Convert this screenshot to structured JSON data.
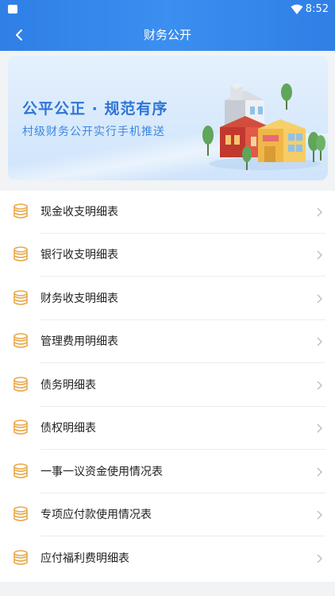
{
  "status_bar": {
    "time": "8:52"
  },
  "nav": {
    "title": "财务公开"
  },
  "banner": {
    "slogan": "公平公正 · 规范有序",
    "subslogan": "村级财务公开实行手机推送"
  },
  "colors": {
    "accent": "#2f7fe6",
    "coin": "#e8a94a"
  },
  "list": {
    "items": [
      {
        "label": "现金收支明细表",
        "icon": "coin-stack-icon"
      },
      {
        "label": "银行收支明细表",
        "icon": "coin-stack-icon"
      },
      {
        "label": "财务收支明细表",
        "icon": "coin-stack-icon"
      },
      {
        "label": "管理费用明细表",
        "icon": "coin-stack-icon"
      },
      {
        "label": "债务明细表",
        "icon": "coin-stack-icon"
      },
      {
        "label": "债权明细表",
        "icon": "coin-stack-icon"
      },
      {
        "label": "一事一议资金使用情况表",
        "icon": "coin-stack-icon"
      },
      {
        "label": "专项应付款使用情况表",
        "icon": "coin-stack-icon"
      },
      {
        "label": "应付福利费明细表",
        "icon": "coin-stack-icon"
      }
    ]
  }
}
